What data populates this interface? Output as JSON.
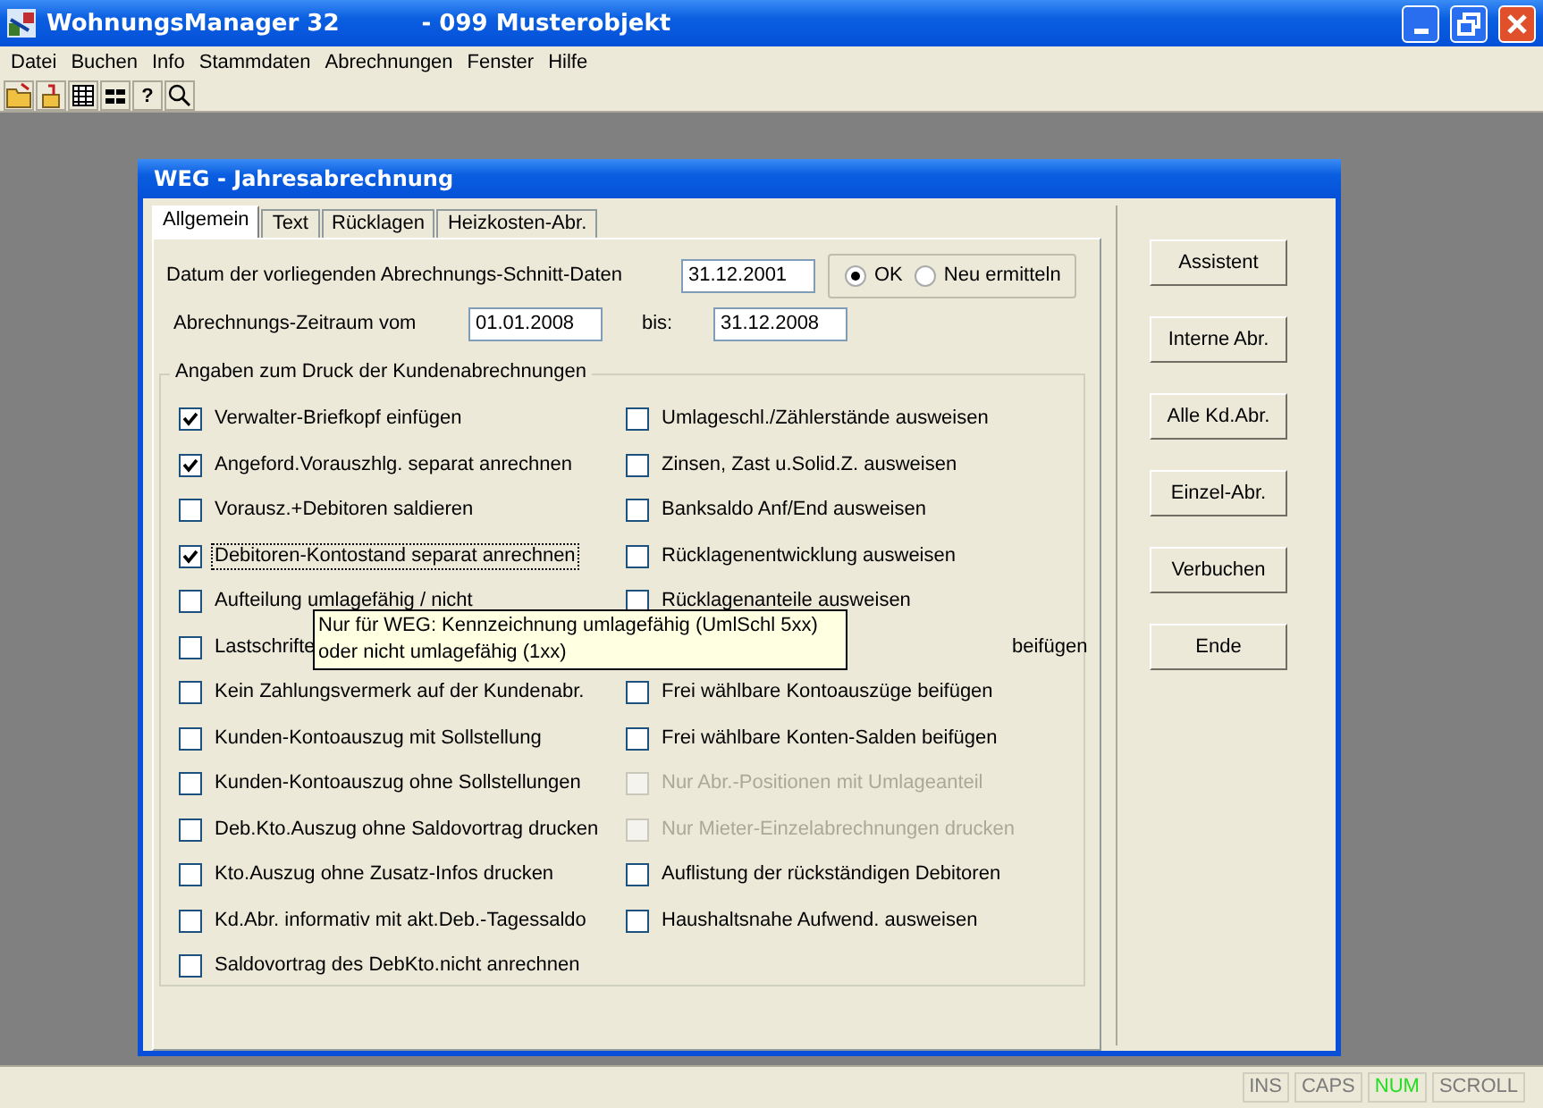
{
  "window": {
    "title": "WohnungsManager 32",
    "subtitle": "- 099 Musterobjekt"
  },
  "menu": [
    "Datei",
    "Buchen",
    "Info",
    "Stammdaten",
    "Abrechnungen",
    "Fenster",
    "Hilfe"
  ],
  "toolbar": [
    "?"
  ],
  "dialog": {
    "title": "WEG - Jahresabrechnung",
    "tabs": [
      {
        "label": "Allgemein",
        "selected": true
      },
      {
        "label": "Text",
        "selected": false
      },
      {
        "label": "Rücklagen",
        "selected": false
      },
      {
        "label": "Heizkosten-Abr.",
        "selected": false
      }
    ],
    "schnitt": {
      "label": "Datum der vorliegenden Abrechnungs-Schnitt-Daten",
      "value": "31.12.2001"
    },
    "radios": [
      {
        "label": "OK",
        "selected": true
      },
      {
        "label": "Neu ermitteln",
        "selected": false
      }
    ],
    "zeitraum": {
      "label": "Abrechnungs-Zeitraum vom",
      "from": "01.01.2008",
      "to_label": "bis:",
      "to": "31.12.2008"
    },
    "group": {
      "title": "Angaben zum Druck der Kundenabrechnungen",
      "left": [
        {
          "kind": "checkbox",
          "label": "Verwalter-Briefkopf einfügen",
          "checked": true,
          "disabled": false,
          "focused": false
        },
        {
          "kind": "checkbox",
          "label": "Angeford.Vorauszhlg. separat anrechnen",
          "checked": true,
          "disabled": false,
          "focused": false
        },
        {
          "kind": "checkbox",
          "label": "Vorausz.+Debitoren saldieren",
          "checked": false,
          "disabled": false,
          "focused": false
        },
        {
          "kind": "checkbox",
          "label": "Debitoren-Kontostand separat anrechnen",
          "checked": true,
          "disabled": false,
          "focused": true
        },
        {
          "kind": "checkbox",
          "label": "Aufteilung umlagefähig / nicht",
          "checked": false,
          "disabled": false,
          "focused": false
        },
        {
          "kind": "checkbox",
          "label": "Lastschrifte",
          "checked": false,
          "disabled": false,
          "focused": false
        },
        {
          "kind": "checkbox",
          "label": "Kein Zahlungsvermerk auf der Kundenabr.",
          "checked": false,
          "disabled": false,
          "focused": false
        },
        {
          "kind": "checkbox",
          "label": "Kunden-Kontoauszug mit Sollstellung",
          "checked": false,
          "disabled": false,
          "focused": false
        },
        {
          "kind": "checkbox",
          "label": "Kunden-Kontoauszug ohne Sollstellungen",
          "checked": false,
          "disabled": false,
          "focused": false
        },
        {
          "kind": "checkbox",
          "label": "Deb.Kto.Auszug ohne Saldovortrag drucken",
          "checked": false,
          "disabled": false,
          "focused": false
        },
        {
          "kind": "checkbox",
          "label": "Kto.Auszug ohne Zusatz-Infos drucken",
          "checked": false,
          "disabled": false,
          "focused": false
        },
        {
          "kind": "checkbox",
          "label": "Kd.Abr. informativ mit akt.Deb.-Tagessaldo",
          "checked": false,
          "disabled": false,
          "focused": false
        },
        {
          "kind": "checkbox",
          "label": "Saldovortrag des DebKto.nicht anrechnen",
          "checked": false,
          "disabled": false,
          "focused": false
        }
      ],
      "right": [
        {
          "kind": "checkbox",
          "label": "Umlageschl./Zählerstände ausweisen",
          "checked": false,
          "disabled": false,
          "focused": false
        },
        {
          "kind": "checkbox",
          "label": "Zinsen, Zast u.Solid.Z. ausweisen",
          "checked": false,
          "disabled": false,
          "focused": false
        },
        {
          "kind": "checkbox",
          "label": "Banksaldo Anf/End ausweisen",
          "checked": false,
          "disabled": false,
          "focused": false
        },
        {
          "kind": "checkbox",
          "label": "Rücklagenentwicklung ausweisen",
          "checked": false,
          "disabled": false,
          "focused": false
        },
        {
          "kind": "checkbox",
          "label": "Rücklagenanteile ausweisen",
          "checked": false,
          "disabled": false,
          "focused": false
        },
        {
          "kind": "covered",
          "label": "beifügen"
        },
        {
          "kind": "checkbox",
          "label": "Frei wählbare Kontoauszüge beifügen",
          "checked": false,
          "disabled": false,
          "focused": false
        },
        {
          "kind": "checkbox",
          "label": "Frei wählbare Konten-Salden beifügen",
          "checked": false,
          "disabled": false,
          "focused": false
        },
        {
          "kind": "checkbox",
          "label": "Nur Abr.-Positionen mit Umlageanteil",
          "checked": false,
          "disabled": true,
          "focused": false
        },
        {
          "kind": "checkbox",
          "label": "Nur Mieter-Einzelabrechnungen drucken",
          "checked": false,
          "disabled": true,
          "focused": false
        },
        {
          "kind": "checkbox",
          "label": "Auflistung der rückständigen Debitoren",
          "checked": false,
          "disabled": false,
          "focused": false
        },
        {
          "kind": "checkbox",
          "label": "Haushaltsnahe Aufwend. ausweisen",
          "checked": false,
          "disabled": false,
          "focused": false
        }
      ]
    },
    "tooltip": [
      "Nur für WEG: Kennzeichnung umlagefähig (UmlSchl 5xx)",
      "oder nicht umlagefähig (1xx)"
    ],
    "buttons": [
      "Assistent",
      "Interne Abr.",
      "Alle Kd.Abr.",
      "Einzel-Abr.",
      "Verbuchen",
      "Ende"
    ]
  },
  "status_bar": [
    {
      "label": "INS",
      "on": false
    },
    {
      "label": "CAPS",
      "on": false
    },
    {
      "label": "NUM",
      "on": true
    },
    {
      "label": "SCROLL",
      "on": false
    }
  ]
}
